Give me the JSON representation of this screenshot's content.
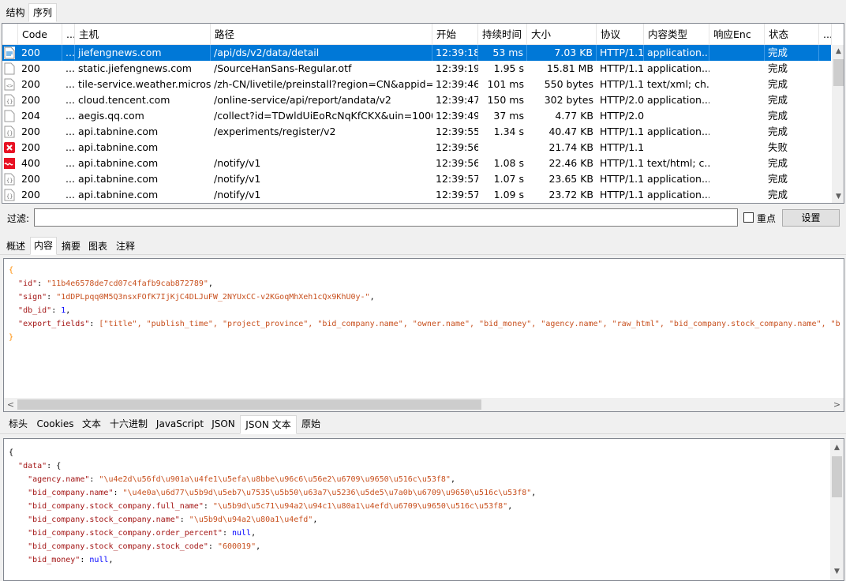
{
  "top_tabs": [
    "结构",
    "序列"
  ],
  "columns": [
    "Code",
    "...",
    "主机",
    "路径",
    "开始",
    "持续时间",
    "大小",
    "协议",
    "内容类型",
    "响应Enc",
    "状态",
    "..."
  ],
  "rows": [
    {
      "icon": "document-icon",
      "code": "200",
      "dots": "...",
      "host": "jiefengnews.com",
      "path": "/api/ds/v2/data/detail",
      "start": "12:39:18",
      "duration": "53 ms",
      "size": "7.03 KB",
      "protocol": "HTTP/1.1",
      "content_type": "application...",
      "enc": "",
      "status": "完成",
      "selected": true
    },
    {
      "icon": "blank-document-icon",
      "code": "200",
      "dots": "...",
      "host": "static.jiefengnews.com",
      "path": "/SourceHanSans-Regular.otf",
      "start": "12:39:19",
      "duration": "1.95 s",
      "size": "15.81 MB",
      "protocol": "HTTP/1.1",
      "content_type": "application...",
      "enc": "",
      "status": "完成"
    },
    {
      "icon": "xml-document-icon",
      "code": "200",
      "dots": "...",
      "host": "tile-service.weather.micros...",
      "path": "/zh-CN/livetile/preinstall?region=CN&appid=...",
      "start": "12:39:46",
      "duration": "101 ms",
      "size": "550 bytes",
      "protocol": "HTTP/1.1",
      "content_type": "text/xml; ch...",
      "enc": "",
      "status": "完成"
    },
    {
      "icon": "json-document-icon",
      "code": "200",
      "dots": "...",
      "host": "cloud.tencent.com",
      "path": "/online-service/api/report/andata/v2",
      "start": "12:39:47",
      "duration": "150 ms",
      "size": "302 bytes",
      "protocol": "HTTP/2.0",
      "content_type": "application...",
      "enc": "",
      "status": "完成"
    },
    {
      "icon": "blank-document-icon",
      "code": "204",
      "dots": "...",
      "host": "aegis.qq.com",
      "path": "/collect?id=TDwldUiEoRcNqKfCKX&uin=1000...",
      "start": "12:39:49",
      "duration": "37 ms",
      "size": "4.77 KB",
      "protocol": "HTTP/2.0",
      "content_type": "",
      "enc": "",
      "status": "完成"
    },
    {
      "icon": "json-document-icon",
      "code": "200",
      "dots": "...",
      "host": "api.tabnine.com",
      "path": "/experiments/register/v2",
      "start": "12:39:55",
      "duration": "1.34 s",
      "size": "40.47 KB",
      "protocol": "HTTP/1.1",
      "content_type": "application...",
      "enc": "",
      "status": "完成"
    },
    {
      "icon": "error-icon",
      "code": "200",
      "dots": "...",
      "host": "api.tabnine.com",
      "path": "",
      "start": "12:39:56",
      "duration": "",
      "size": "21.74 KB",
      "protocol": "HTTP/1.1",
      "content_type": "",
      "enc": "",
      "status": "失败"
    },
    {
      "icon": "html-document-icon",
      "code": "400",
      "dots": "...",
      "host": "api.tabnine.com",
      "path": "/notify/v1",
      "start": "12:39:56",
      "duration": "1.08 s",
      "size": "22.46 KB",
      "protocol": "HTTP/1.1",
      "content_type": "text/html; c...",
      "enc": "",
      "status": "完成"
    },
    {
      "icon": "json-document-icon",
      "code": "200",
      "dots": "...",
      "host": "api.tabnine.com",
      "path": "/notify/v1",
      "start": "12:39:57",
      "duration": "1.07 s",
      "size": "23.65 KB",
      "protocol": "HTTP/1.1",
      "content_type": "application...",
      "enc": "",
      "status": "完成"
    },
    {
      "icon": "json-document-icon",
      "code": "200",
      "dots": "...",
      "host": "api.tabnine.com",
      "path": "/notify/v1",
      "start": "12:39:57",
      "duration": "1.09 s",
      "size": "23.72 KB",
      "protocol": "HTTP/1.1",
      "content_type": "application...",
      "enc": "",
      "status": "完成"
    }
  ],
  "filter": {
    "label": "过滤:",
    "value": "",
    "checkbox_label": "重点",
    "settings_label": "设置"
  },
  "detail_tabs": [
    "概述",
    "内容",
    "摘要",
    "图表",
    "注释"
  ],
  "request_body": [
    {
      "t": "b",
      "v": "{"
    },
    {
      "t": "kv",
      "k": "\"id\"",
      "v": "\"11b4e6578de7cd07c4fafb9cab872789\"",
      "end": ","
    },
    {
      "t": "kv",
      "k": "\"sign\"",
      "v": "\"1dDPLpqq0M5Q3nsxFOfK7IjKjC4DLJuFW_2NYUxCC-v2KGoqMhXeh1cQx9KhU0y-\"",
      "end": ","
    },
    {
      "t": "kvn",
      "k": "\"db_id\"",
      "v": "1",
      "end": ","
    },
    {
      "t": "arr",
      "k": "\"export_fields\"",
      "v": "[\"title\", \"publish_time\", \"project_province\", \"bid_company.name\", \"owner.name\", \"bid_money\", \"agency.name\", \"raw_html\", \"bid_company.stock_company.name\", \"bid_company.stock_company.stock_code\"]"
    },
    {
      "t": "b",
      "v": "}"
    }
  ],
  "response_tabs": [
    "标头",
    "Cookies",
    "文本",
    "十六进制",
    "JavaScript",
    "JSON",
    "JSON 文本",
    "原始"
  ],
  "response_body": [
    {
      "t": "plain",
      "v": "{"
    },
    {
      "t": "open",
      "k": "\"data\"",
      "v": "{"
    },
    {
      "t": "kv",
      "k": "\"agency.name\"",
      "v": "\"\\u4e2d\\u56fd\\u901a\\u4fe1\\u5efa\\u8bbe\\u96c6\\u56e2\\u6709\\u9650\\u516c\\u53f8\"",
      "end": ","
    },
    {
      "t": "kv",
      "k": "\"bid_company.name\"",
      "v": "\"\\u4e0a\\u6d77\\u5b9d\\u5eb7\\u7535\\u5b50\\u63a7\\u5236\\u5de5\\u7a0b\\u6709\\u9650\\u516c\\u53f8\"",
      "end": ","
    },
    {
      "t": "kv",
      "k": "\"bid_company.stock_company.full_name\"",
      "v": "\"\\u5b9d\\u5c71\\u94a2\\u94c1\\u80a1\\u4efd\\u6709\\u9650\\u516c\\u53f8\"",
      "end": ","
    },
    {
      "t": "kv",
      "k": "\"bid_company.stock_company.name\"",
      "v": "\"\\u5b9d\\u94a2\\u80a1\\u4efd\"",
      "end": ","
    },
    {
      "t": "kvn",
      "k": "\"bid_company.stock_company.order_percent\"",
      "v": "null",
      "end": ","
    },
    {
      "t": "kv",
      "k": "\"bid_company.stock_company.stock_code\"",
      "v": "\"600019\"",
      "end": ","
    },
    {
      "t": "kvn",
      "k": "\"bid_money\"",
      "v": "null",
      "end": ","
    }
  ]
}
